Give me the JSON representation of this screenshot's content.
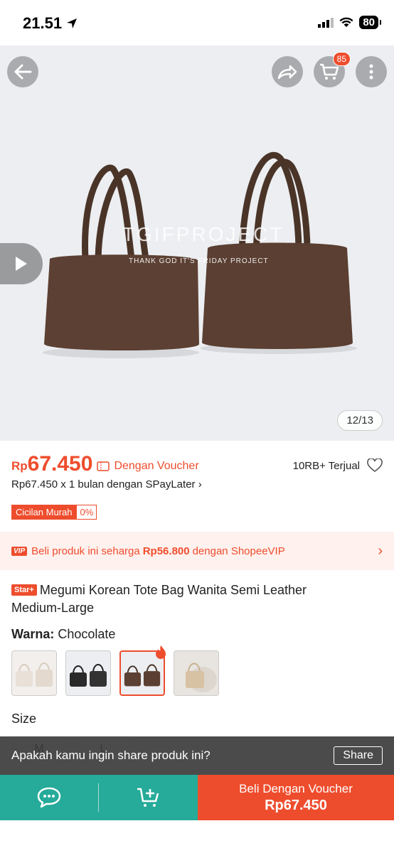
{
  "status": {
    "time": "21.51",
    "battery": "80"
  },
  "hero": {
    "cart_count": "85",
    "watermark": "TGIFPROJECT",
    "watermark_sub": "THANK GOD IT'S FRIDAY PROJECT",
    "counter": "12/13"
  },
  "price": {
    "currency": "Rp",
    "amount": "67.450",
    "voucher_label": "Dengan Voucher",
    "sold": "10RB+ Terjual",
    "spaylater": "Rp67.450 x 1 bulan dengan SPayLater",
    "cicilan_label": "Cicilan Murah",
    "cicilan_pct": "0%"
  },
  "vip": {
    "badge": "VIP",
    "text_before": "Beli produk ini seharga",
    "vip_price": "Rp56.800",
    "text_after": "dengan ShopeeVIP"
  },
  "product": {
    "badge": "Star+",
    "title": "Megumi Korean Tote Bag Wanita Semi Leather Medium-Large"
  },
  "variant": {
    "label": "Warna:",
    "selected": "Chocolate",
    "colors": [
      "#e9e0d8",
      "#2a2a2a",
      "#5c4033",
      "#d8c2a4"
    ]
  },
  "size": {
    "label": "Size",
    "options": [
      "M",
      "L"
    ]
  },
  "share": {
    "prompt": "Apakah kamu ingin share produk ini?",
    "button": "Share"
  },
  "bottom": {
    "buy_label": "Beli Dengan Voucher",
    "buy_price": "Rp67.450"
  },
  "colors": {
    "accent": "#ee4d2d",
    "teal": "#26aa99"
  }
}
